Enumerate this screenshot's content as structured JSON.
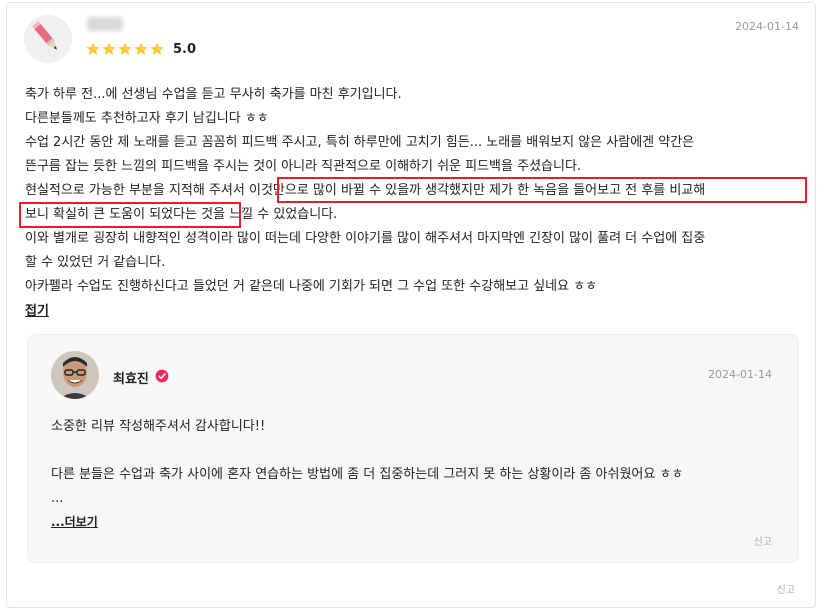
{
  "review": {
    "rating": "5.0",
    "stars": 5,
    "date": "2024-01-14",
    "lines": [
      "축가 하루 전...에 선생님 수업을 듣고 무사히 축가를 마친 후기입니다.",
      "다른분들께도 추천하고자 후기 남깁니다 ㅎㅎ",
      "수업 2시간 동안 제 노래를 듣고 꼼꼼히 피드백 주시고, 특히 하루만에 고치기 힘든... 노래를 배워보지 않은 사람에겐 약간은",
      "뜬구름 잡는 듯한 느낌의 피드백을 주시는 것이 아니라 직관적으로 이해하기 쉬운 피드백을 주셨습니다.",
      "현실적으로 가능한 부분을 지적해 주셔서 이것만으로 많이 바뀔 수 있을까 생각했지만 제가 한 녹음을 들어보고 전 후를 비교해",
      "보니 확실히 큰 도움이 되었다는 것을 느낄 수 있었습니다.",
      "이와 별개로 굉장히 내향적인 성격이라 많이 떠는데 다양한 이야기를 많이 해주셔서 마지막엔 긴장이 많이 풀려 더 수업에 집중",
      "할 수 있었던 거 같습니다.",
      "아카펠라 수업도 진행하신다고 들었던 거 같은데 나중에 기회가 되면 그 수업 또한 수강해보고 싶네요 ㅎㅎ"
    ],
    "fold_label": "접기",
    "report_label": "신고"
  },
  "reply": {
    "name": "최효진",
    "date": "2024-01-14",
    "lines": [
      "소중한 리뷰 작성해주셔서 감사합니다!!",
      "",
      "다른 분들은 수업과 축가 사이에 혼자 연습하는 방법에 좀 더 집중하는데 그러지 못 하는 상황이라 좀 아쉬웠어요 ㅎㅎ",
      "..."
    ],
    "more_label": "...더보기",
    "report_label": "신고"
  },
  "colors": {
    "star": "#ffc83d",
    "highlight": "#e41f2a",
    "verified": "#f0295c"
  }
}
